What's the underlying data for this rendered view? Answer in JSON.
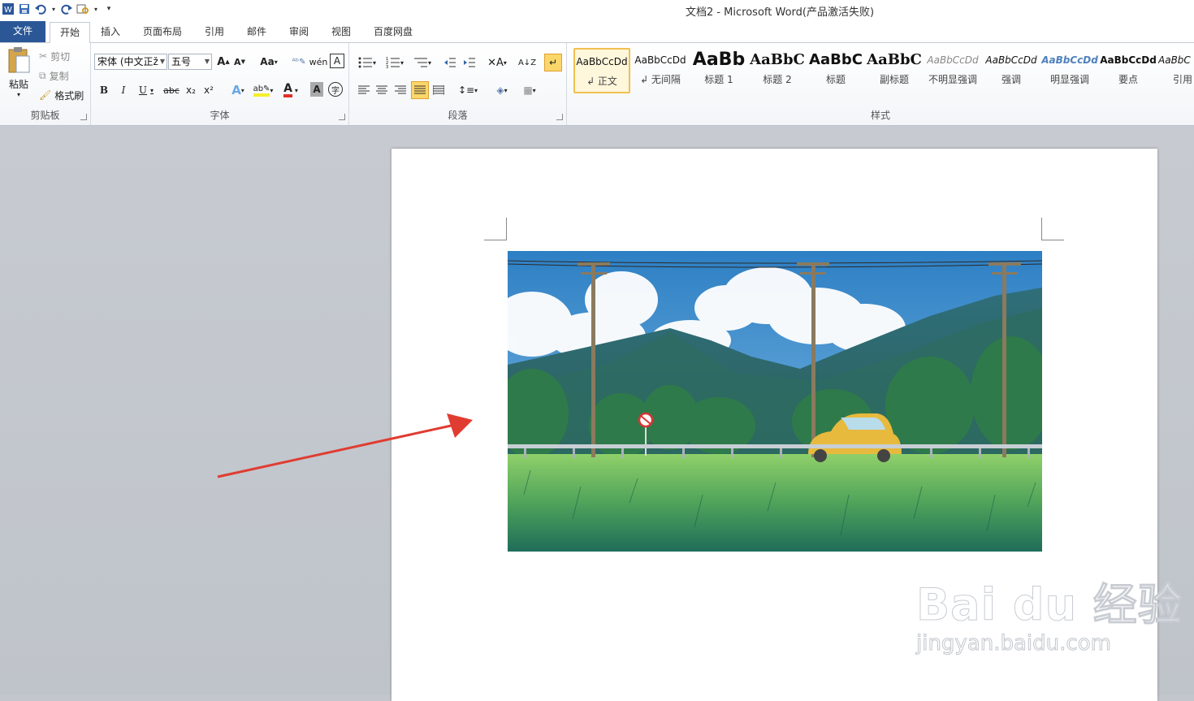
{
  "window": {
    "title": "文档2  -  Microsoft Word(产品激活失败)"
  },
  "qat": {
    "customize_label": "▾"
  },
  "tabs": [
    "文件",
    "开始",
    "插入",
    "页面布局",
    "引用",
    "邮件",
    "审阅",
    "视图",
    "百度网盘"
  ],
  "clipboard": {
    "paste": "粘贴",
    "cut": "剪切",
    "copy": "复制",
    "format_painter": "格式刷",
    "label": "剪贴板"
  },
  "font": {
    "name": "宋体 (中文正ž",
    "size": "五号",
    "label": "字体",
    "bold": "B",
    "italic": "I",
    "underline": "U",
    "strike": "abc",
    "sub": "x₂",
    "sup": "x²",
    "grow": "A",
    "shrink": "A",
    "case": "Aa",
    "color_a": "A",
    "char_border": "A",
    "char_shade": "A",
    "enclose": "字"
  },
  "paragraph": {
    "label": "段落"
  },
  "styles": {
    "label": "样式",
    "items": [
      {
        "sample": "AaBbCcDd",
        "name": "↲ 正文"
      },
      {
        "sample": "AaBbCcDd",
        "name": "↲ 无间隔"
      },
      {
        "sample": "AaBb",
        "name": "标题 1"
      },
      {
        "sample": "AaBbC",
        "name": "标题 2"
      },
      {
        "sample": "AaBbC",
        "name": "标题"
      },
      {
        "sample": "AaBbC",
        "name": "副标题"
      },
      {
        "sample": "AaBbCcDd",
        "name": "不明显强调"
      },
      {
        "sample": "AaBbCcDd",
        "name": "强调"
      },
      {
        "sample": "AaBbCcDd",
        "name": "明显强调"
      },
      {
        "sample": "AaBbCcDd",
        "name": "要点"
      },
      {
        "sample": "AaBbC",
        "name": "引用"
      }
    ]
  },
  "watermark": {
    "line1": "Bai du 经验",
    "line2": "jingyan.baidu.com"
  },
  "colors": {
    "file_tab": "#2b5797",
    "arrow": "#e03c31",
    "selected_style": "#f0c050"
  }
}
